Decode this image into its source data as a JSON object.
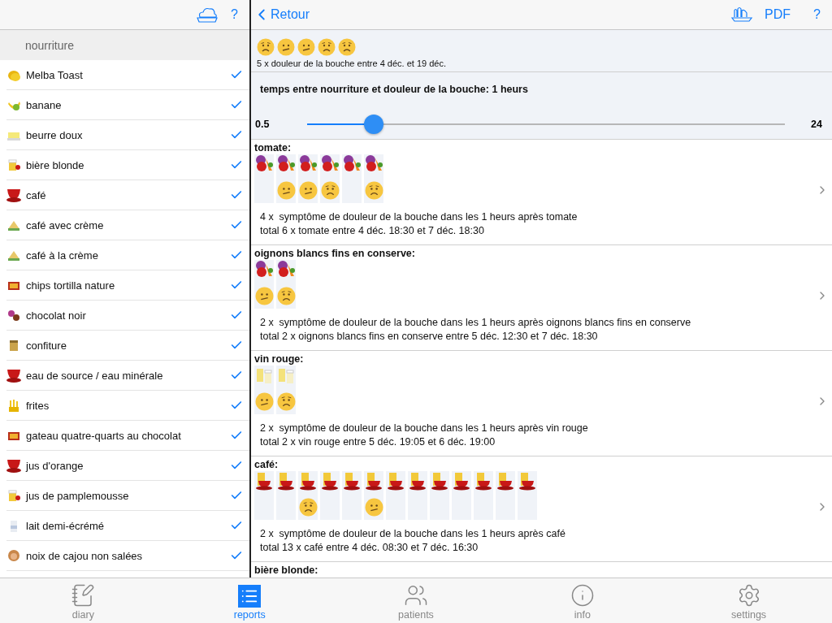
{
  "sidebar": {
    "help": "?",
    "section_title": "nourriture",
    "foods": [
      {
        "name": "Melba Toast",
        "kind": "toast",
        "checked": true
      },
      {
        "name": "banane",
        "kind": "fruit",
        "checked": true
      },
      {
        "name": "beurre doux",
        "kind": "butter",
        "checked": true
      },
      {
        "name": "bière blonde",
        "kind": "beer",
        "checked": true
      },
      {
        "name": "café",
        "kind": "cup",
        "checked": true
      },
      {
        "name": "café avec crème",
        "kind": "cake",
        "checked": true
      },
      {
        "name": "café à la crème",
        "kind": "cake",
        "checked": true
      },
      {
        "name": "chips tortilla nature",
        "kind": "chips",
        "checked": true
      },
      {
        "name": "chocolat noir",
        "kind": "candy",
        "checked": true
      },
      {
        "name": "confiture",
        "kind": "jar",
        "checked": true
      },
      {
        "name": "eau de source / eau minérale",
        "kind": "cup",
        "checked": true
      },
      {
        "name": "frites",
        "kind": "fries",
        "checked": true
      },
      {
        "name": "gateau quatre-quarts au chocolat",
        "kind": "chips",
        "checked": true
      },
      {
        "name": "jus d'orange",
        "kind": "cup",
        "checked": true
      },
      {
        "name": "jus de pamplemousse",
        "kind": "beer",
        "checked": true
      },
      {
        "name": "lait demi-écrémé",
        "kind": "milk",
        "checked": true
      },
      {
        "name": "noix de cajou non salées",
        "kind": "nut",
        "checked": true
      }
    ]
  },
  "navbar": {
    "back": "Retour",
    "pdf": "PDF",
    "help": "?"
  },
  "summary": {
    "faces": [
      {
        "kind": "worried"
      },
      {
        "kind": "confused"
      },
      {
        "kind": "confused"
      },
      {
        "kind": "worried"
      },
      {
        "kind": "worried"
      }
    ],
    "text": "5 x douleur de la bouche entre 4 déc. et 19 déc."
  },
  "interval": {
    "title": "temps entre nourriture et douleur de la bouche: 1 heurs",
    "min": "0.5",
    "max": "24",
    "level": 0.14
  },
  "reports": [
    {
      "title": "tomate:",
      "kind": "vegetables",
      "entries": [
        {
          "kind": "none"
        },
        {
          "kind": "confused"
        },
        {
          "kind": "confused"
        },
        {
          "kind": "worried"
        },
        {
          "kind": "none"
        },
        {
          "kind": "worried"
        }
      ],
      "line1": "4 x  symptôme de douleur de la bouche dans les 1 heurs après tomate",
      "line2": "total 6 x tomate entre 4 déc. 18:30 et 7 déc. 18:30"
    },
    {
      "title": "oignons blancs fins en conserve:",
      "kind": "vegetables",
      "entries": [
        {
          "kind": "confused"
        },
        {
          "kind": "worried"
        }
      ],
      "line1": "2 x  symptôme de douleur de la bouche dans les 1 heurs après oignons blancs fins en conserve",
      "line2": "total 2 x oignons blancs fins en conserve entre 5 déc. 12:30 et 7 déc. 18:30"
    },
    {
      "title": "vin rouge:",
      "kind": "drink",
      "entries": [
        {
          "kind": "confused"
        },
        {
          "kind": "worried"
        }
      ],
      "line1": "2 x  symptôme de douleur de la bouche dans les 1 heurs après vin rouge",
      "line2": "total 2 x vin rouge entre 5 déc. 19:05 et 6 déc. 19:00"
    },
    {
      "title": "café:",
      "kind": "coffee",
      "entries": [
        {
          "kind": "none"
        },
        {
          "kind": "none"
        },
        {
          "kind": "worried"
        },
        {
          "kind": "none"
        },
        {
          "kind": "none"
        },
        {
          "kind": "confused"
        },
        {
          "kind": "none"
        },
        {
          "kind": "none"
        },
        {
          "kind": "none"
        },
        {
          "kind": "none"
        },
        {
          "kind": "none"
        },
        {
          "kind": "none"
        },
        {
          "kind": "none"
        }
      ],
      "line1": "2 x  symptôme de douleur de la bouche dans les 1 heurs après café",
      "line2": "total 13 x café entre 4 déc. 08:30 et 7 déc. 16:30"
    },
    {
      "title": "bière blonde:"
    }
  ],
  "tabs": [
    {
      "label": "diary",
      "kind": "diary",
      "selected": false
    },
    {
      "label": "reports",
      "kind": "reports",
      "selected": true
    },
    {
      "label": "patients",
      "kind": "patients",
      "selected": false
    },
    {
      "label": "info",
      "kind": "info",
      "selected": false
    },
    {
      "label": "settings",
      "kind": "settings",
      "selected": false
    }
  ]
}
